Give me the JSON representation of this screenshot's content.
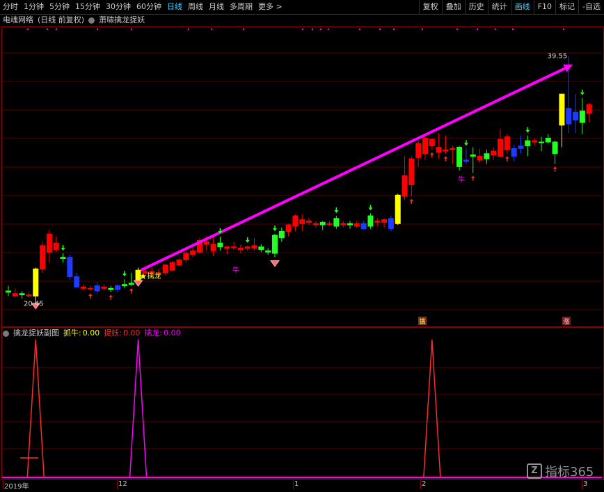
{
  "toolbar": {
    "periods": [
      "分时",
      "1分钟",
      "5分钟",
      "15分钟",
      "30分钟",
      "60分钟",
      "日线",
      "周线",
      "月线",
      "多周期",
      "更多 >"
    ],
    "active_period": "日线",
    "right_buttons": [
      "复权",
      "叠加",
      "历史",
      "统计",
      "画线",
      "F10",
      "标记",
      "-自选"
    ],
    "active_right": "画线"
  },
  "main_panel": {
    "stock_title": "电魂网络",
    "mode": "(日线 前复权)",
    "indicator": "萧啸擒龙捉妖",
    "high_label": "39.55",
    "low_label": "20.45",
    "signal_label": "擒龙",
    "niu_labels": [
      "牛",
      "牛"
    ],
    "marker_qin": "擒",
    "marker_zhang": "涨"
  },
  "sub_panel": {
    "name": "擒龙捉妖副图",
    "zhuaniu_label": "抓牛:",
    "zhuaniu_value": "0.00",
    "zhuoyao_label": "捉妖:",
    "zhuoyao_value": "0.00",
    "qinlong_label": "擒龙:",
    "qinlong_value": "0.00"
  },
  "x_axis": {
    "labels": [
      "2019年",
      "12",
      "1",
      "2",
      "3"
    ]
  },
  "watermark": "指标365",
  "colors": {
    "up": "#ff2a2a",
    "down": "#00e5ff",
    "blue": "#1f3bff",
    "yellow": "#ffff00",
    "green": "#22ff22",
    "magenta": "#ff00ff",
    "grid": "#5a0000"
  },
  "chart_data": {
    "type": "candlestick",
    "price_range": [
      20.45,
      39.55
    ],
    "candles": [
      {
        "o": 21.3,
        "h": 21.8,
        "l": 21.0,
        "c": 21.4,
        "color": "green"
      },
      {
        "o": 21.2,
        "h": 21.6,
        "l": 20.9,
        "c": 21.0,
        "color": "red"
      },
      {
        "o": 21.1,
        "h": 21.4,
        "l": 20.8,
        "c": 21.2,
        "color": "green"
      },
      {
        "o": 21.0,
        "h": 21.3,
        "l": 20.9,
        "c": 21.1,
        "color": "red"
      },
      {
        "o": 21.0,
        "h": 23.2,
        "l": 20.45,
        "c": 23.1,
        "color": "yellow"
      },
      {
        "o": 23.1,
        "h": 25.2,
        "l": 22.8,
        "c": 24.9,
        "color": "red"
      },
      {
        "o": 24.4,
        "h": 26.1,
        "l": 23.6,
        "c": 25.8,
        "color": "red"
      },
      {
        "o": 25.1,
        "h": 25.6,
        "l": 24.4,
        "c": 24.6,
        "color": "red"
      },
      {
        "o": 23.9,
        "h": 24.3,
        "l": 23.6,
        "c": 24.0,
        "color": "green"
      },
      {
        "o": 24.0,
        "h": 24.2,
        "l": 22.3,
        "c": 22.5,
        "color": "blue"
      },
      {
        "o": 22.5,
        "h": 22.8,
        "l": 21.6,
        "c": 21.7,
        "color": "blue"
      },
      {
        "o": 21.7,
        "h": 21.9,
        "l": 21.4,
        "c": 21.6,
        "color": "red"
      },
      {
        "o": 21.6,
        "h": 21.8,
        "l": 21.4,
        "c": 21.6,
        "color": "red"
      },
      {
        "o": 21.4,
        "h": 22.1,
        "l": 21.2,
        "c": 21.8,
        "color": "blue"
      },
      {
        "o": 21.6,
        "h": 21.9,
        "l": 21.4,
        "c": 21.7,
        "color": "red"
      },
      {
        "o": 21.6,
        "h": 21.8,
        "l": 21.3,
        "c": 21.5,
        "color": "green"
      },
      {
        "o": 21.5,
        "h": 21.9,
        "l": 21.3,
        "c": 21.8,
        "color": "blue"
      },
      {
        "o": 21.8,
        "h": 22.3,
        "l": 21.6,
        "c": 21.9,
        "color": "green"
      },
      {
        "o": 21.9,
        "h": 22.8,
        "l": 21.8,
        "c": 22.0,
        "color": "green"
      },
      {
        "o": 22.2,
        "h": 23.2,
        "l": 22.0,
        "c": 23.0,
        "color": "yellow"
      },
      {
        "o": 22.8,
        "h": 23.1,
        "l": 22.6,
        "c": 22.9,
        "color": "red"
      },
      {
        "o": 22.8,
        "h": 23.2,
        "l": 22.6,
        "c": 22.9,
        "color": "red"
      },
      {
        "o": 22.8,
        "h": 23.1,
        "l": 22.5,
        "c": 22.8,
        "color": "red"
      },
      {
        "o": 22.8,
        "h": 23.5,
        "l": 22.6,
        "c": 23.4,
        "color": "red"
      },
      {
        "o": 23.0,
        "h": 23.7,
        "l": 22.9,
        "c": 23.6,
        "color": "red"
      },
      {
        "o": 23.4,
        "h": 23.9,
        "l": 23.3,
        "c": 23.8,
        "color": "red"
      },
      {
        "o": 23.8,
        "h": 24.5,
        "l": 23.6,
        "c": 24.3,
        "color": "red"
      },
      {
        "o": 24.2,
        "h": 24.8,
        "l": 24.0,
        "c": 24.5,
        "color": "red"
      },
      {
        "o": 24.4,
        "h": 25.5,
        "l": 24.3,
        "c": 25.3,
        "color": "red"
      },
      {
        "o": 25.2,
        "h": 25.6,
        "l": 24.5,
        "c": 25.0,
        "color": "red"
      },
      {
        "o": 25.0,
        "h": 25.6,
        "l": 24.1,
        "c": 24.5,
        "color": "red"
      },
      {
        "o": 24.8,
        "h": 25.6,
        "l": 24.5,
        "c": 25.1,
        "color": "green"
      },
      {
        "o": 24.7,
        "h": 24.9,
        "l": 24.2,
        "c": 24.8,
        "color": "red"
      },
      {
        "o": 24.8,
        "h": 25.2,
        "l": 24.6,
        "c": 24.8,
        "color": "red"
      },
      {
        "o": 24.6,
        "h": 25.0,
        "l": 24.3,
        "c": 24.7,
        "color": "red"
      },
      {
        "o": 24.7,
        "h": 24.9,
        "l": 24.5,
        "c": 24.8,
        "color": "red"
      },
      {
        "o": 24.7,
        "h": 25.5,
        "l": 24.5,
        "c": 24.9,
        "color": "red"
      },
      {
        "o": 24.8,
        "h": 25.0,
        "l": 24.4,
        "c": 24.6,
        "color": "green"
      },
      {
        "o": 24.5,
        "h": 24.7,
        "l": 24.2,
        "c": 24.4,
        "color": "green"
      },
      {
        "o": 24.3,
        "h": 25.8,
        "l": 24.0,
        "c": 25.7,
        "color": "green"
      },
      {
        "o": 25.5,
        "h": 26.3,
        "l": 25.2,
        "c": 26.0,
        "color": "green"
      },
      {
        "o": 26.0,
        "h": 26.6,
        "l": 25.6,
        "c": 26.5,
        "color": "red"
      },
      {
        "o": 26.4,
        "h": 27.3,
        "l": 26.0,
        "c": 27.2,
        "color": "red"
      },
      {
        "o": 26.6,
        "h": 27.3,
        "l": 26.0,
        "c": 26.9,
        "color": "red"
      },
      {
        "o": 26.8,
        "h": 27.0,
        "l": 26.5,
        "c": 26.7,
        "color": "red"
      },
      {
        "o": 26.6,
        "h": 26.8,
        "l": 26.3,
        "c": 26.6,
        "color": "red"
      },
      {
        "o": 26.5,
        "h": 26.8,
        "l": 26.1,
        "c": 26.7,
        "color": "green"
      },
      {
        "o": 26.6,
        "h": 26.8,
        "l": 26.4,
        "c": 26.6,
        "color": "red"
      },
      {
        "o": 26.4,
        "h": 27.2,
        "l": 26.2,
        "c": 27.0,
        "color": "green"
      },
      {
        "o": 26.6,
        "h": 26.8,
        "l": 26.3,
        "c": 26.5,
        "color": "red"
      },
      {
        "o": 26.5,
        "h": 26.8,
        "l": 26.2,
        "c": 26.6,
        "color": "green"
      },
      {
        "o": 26.4,
        "h": 26.8,
        "l": 26.3,
        "c": 26.6,
        "color": "red"
      },
      {
        "o": 26.6,
        "h": 26.8,
        "l": 26.1,
        "c": 26.2,
        "color": "blue"
      },
      {
        "o": 26.4,
        "h": 27.4,
        "l": 26.2,
        "c": 27.2,
        "color": "green"
      },
      {
        "o": 26.7,
        "h": 27.0,
        "l": 26.4,
        "c": 26.8,
        "color": "red"
      },
      {
        "o": 26.7,
        "h": 27.0,
        "l": 26.3,
        "c": 26.9,
        "color": "red"
      },
      {
        "o": 27.0,
        "h": 27.2,
        "l": 26.0,
        "c": 26.2,
        "color": "blue"
      },
      {
        "o": 26.6,
        "h": 28.9,
        "l": 26.5,
        "c": 28.8,
        "color": "yellow"
      },
      {
        "o": 28.7,
        "h": 31.8,
        "l": 28.4,
        "c": 30.3,
        "color": "red"
      },
      {
        "o": 29.6,
        "h": 31.8,
        "l": 28.7,
        "c": 31.6,
        "color": "red"
      },
      {
        "o": 31.7,
        "h": 33.0,
        "l": 31.0,
        "c": 32.8,
        "color": "red"
      },
      {
        "o": 32.0,
        "h": 33.3,
        "l": 31.5,
        "c": 33.2,
        "color": "red"
      },
      {
        "o": 32.6,
        "h": 33.2,
        "l": 32.3,
        "c": 33.1,
        "color": "red"
      },
      {
        "o": 32.1,
        "h": 33.6,
        "l": 31.6,
        "c": 32.5,
        "color": "red"
      },
      {
        "o": 32.2,
        "h": 33.4,
        "l": 32.0,
        "c": 32.3,
        "color": "red"
      },
      {
        "o": 32.4,
        "h": 32.6,
        "l": 31.2,
        "c": 32.4,
        "color": "red"
      },
      {
        "o": 32.5,
        "h": 32.6,
        "l": 30.7,
        "c": 31.0,
        "color": "green"
      },
      {
        "o": 31.4,
        "h": 32.4,
        "l": 31.2,
        "c": 31.5,
        "color": "blue"
      },
      {
        "o": 31.8,
        "h": 32.5,
        "l": 30.5,
        "c": 31.9,
        "color": "green"
      },
      {
        "o": 31.5,
        "h": 32.4,
        "l": 31.3,
        "c": 31.8,
        "color": "red"
      },
      {
        "o": 31.6,
        "h": 32.3,
        "l": 31.2,
        "c": 32.0,
        "color": "green"
      },
      {
        "o": 31.9,
        "h": 32.5,
        "l": 31.5,
        "c": 32.2,
        "color": "red"
      },
      {
        "o": 31.8,
        "h": 33.9,
        "l": 31.7,
        "c": 33.1,
        "color": "red"
      },
      {
        "o": 33.3,
        "h": 33.5,
        "l": 32.0,
        "c": 32.3,
        "color": "red"
      },
      {
        "o": 32.4,
        "h": 32.7,
        "l": 31.4,
        "c": 31.8,
        "color": "blue"
      },
      {
        "o": 32.4,
        "h": 33.4,
        "l": 32.0,
        "c": 32.6,
        "color": "blue"
      },
      {
        "o": 32.6,
        "h": 33.4,
        "l": 31.8,
        "c": 33.0,
        "color": "green"
      },
      {
        "o": 33.0,
        "h": 33.2,
        "l": 32.6,
        "c": 32.9,
        "color": "red"
      },
      {
        "o": 32.9,
        "h": 33.3,
        "l": 32.2,
        "c": 32.9,
        "color": "green"
      },
      {
        "o": 32.9,
        "h": 33.5,
        "l": 32.8,
        "c": 33.2,
        "color": "green"
      },
      {
        "o": 32.0,
        "h": 33.0,
        "l": 31.2,
        "c": 32.9,
        "color": "green"
      },
      {
        "o": 34.2,
        "h": 35.8,
        "l": 32.5,
        "c": 36.6,
        "color": "yellow"
      },
      {
        "o": 34.3,
        "h": 39.55,
        "l": 33.6,
        "c": 35.5,
        "color": "blue"
      },
      {
        "o": 35.2,
        "h": 36.6,
        "l": 33.6,
        "c": 34.6,
        "color": "blue"
      },
      {
        "o": 35.3,
        "h": 36.3,
        "l": 33.5,
        "c": 34.4,
        "color": "green"
      },
      {
        "o": 35.1,
        "h": 35.9,
        "l": 34.4,
        "c": 35.8,
        "color": "red"
      }
    ],
    "trend_arrow": {
      "from_index": 19,
      "from_price": 22.9,
      "to_index": 82,
      "to_price": 39.1
    },
    "sub_indicator": {
      "series": [
        {
          "name": "抓牛",
          "values": [
            0,
            0,
            0,
            0,
            1
          ]
        },
        {
          "name": "捉妖",
          "values": [
            1,
            0,
            1
          ]
        },
        {
          "name": "擒龙",
          "values": [
            1
          ]
        }
      ]
    }
  }
}
